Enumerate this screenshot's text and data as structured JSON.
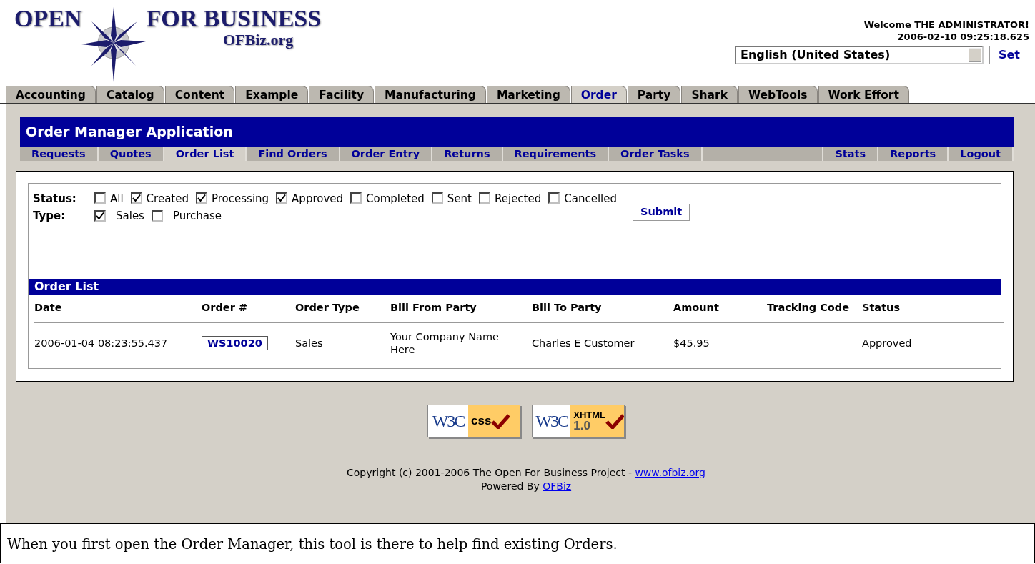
{
  "logo": {
    "word_left": "OPEN",
    "word_right": "FOR BUSINESS",
    "subtitle": "OFBiz.org"
  },
  "user": {
    "welcome": "Welcome THE ADMINISTRATOR!",
    "timestamp": "2006-02-10 09:25:18.625",
    "locale": "English (United States)",
    "set_button": "Set"
  },
  "tabs": [
    {
      "label": "Accounting",
      "selected": false
    },
    {
      "label": "Catalog",
      "selected": false
    },
    {
      "label": "Content",
      "selected": false
    },
    {
      "label": "Example",
      "selected": false
    },
    {
      "label": "Facility",
      "selected": false
    },
    {
      "label": "Manufacturing",
      "selected": false
    },
    {
      "label": "Marketing",
      "selected": false
    },
    {
      "label": "Order",
      "selected": true
    },
    {
      "label": "Party",
      "selected": false
    },
    {
      "label": "Shark",
      "selected": false
    },
    {
      "label": "WebTools",
      "selected": false
    },
    {
      "label": "Work Effort",
      "selected": false
    }
  ],
  "app_title": "Order Manager Application",
  "subnav_left": [
    {
      "label": "Requests",
      "selected": false
    },
    {
      "label": "Quotes",
      "selected": false
    },
    {
      "label": "Order List",
      "selected": true
    },
    {
      "label": "Find Orders",
      "selected": false
    },
    {
      "label": "Order Entry",
      "selected": false
    },
    {
      "label": "Returns",
      "selected": false
    },
    {
      "label": "Requirements",
      "selected": false
    },
    {
      "label": "Order Tasks",
      "selected": false
    }
  ],
  "subnav_right": [
    {
      "label": "Stats",
      "selected": false
    },
    {
      "label": "Reports",
      "selected": false
    },
    {
      "label": "Logout",
      "selected": false
    }
  ],
  "filters": {
    "status_label": "Status:",
    "status_options": [
      {
        "label": "All",
        "checked": false
      },
      {
        "label": "Created",
        "checked": true
      },
      {
        "label": "Processing",
        "checked": true
      },
      {
        "label": "Approved",
        "checked": true
      },
      {
        "label": "Completed",
        "checked": false
      },
      {
        "label": "Sent",
        "checked": false
      },
      {
        "label": "Rejected",
        "checked": false
      },
      {
        "label": "Cancelled",
        "checked": false
      }
    ],
    "type_label": "Type:",
    "type_options": [
      {
        "label": "Sales",
        "checked": true
      },
      {
        "label": "Purchase",
        "checked": false
      }
    ],
    "submit_button": "Submit"
  },
  "order_list": {
    "title": "Order List",
    "columns": [
      "Date",
      "Order #",
      "Order Type",
      "Bill From Party",
      "Bill To Party",
      "Amount",
      "Tracking Code",
      "Status"
    ],
    "rows": [
      {
        "date": "2006-01-04 08:23:55.437",
        "order_number": "WS10020",
        "order_type": "Sales",
        "bill_from": "Your Company Name Here",
        "bill_to": "Charles E Customer",
        "amount": "$45.95",
        "status": "Approved"
      }
    ]
  },
  "badges": [
    {
      "kind": "css",
      "logo": "W3C",
      "line_1": "css"
    },
    {
      "kind": "xhtml",
      "logo": "W3C",
      "line_1": "XHTML",
      "line_2": "1.0"
    }
  ],
  "footer": {
    "copyright": "Copyright (c) 2001-2006 The Open For Business Project -",
    "site_link": "www.ofbiz.org",
    "powered_by": "Powered By",
    "powered_link": "OFBiz"
  },
  "caption": "When you first open the Order Manager, this tool is there to help find existing Orders."
}
